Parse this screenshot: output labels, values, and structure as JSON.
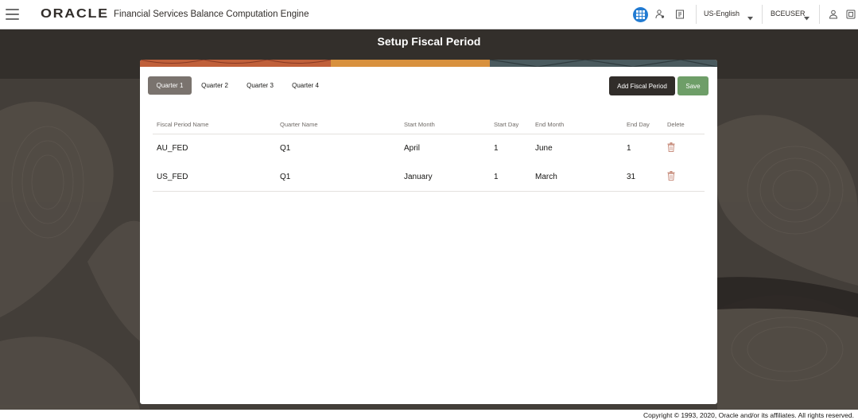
{
  "header": {
    "brand": "ORACLE",
    "app_name": "Financial Services Balance Computation Engine",
    "language": "US-English",
    "user": "BCEUSER"
  },
  "page": {
    "title": "Setup Fiscal Period"
  },
  "tabs": [
    {
      "label": "Quarter 1",
      "active": true
    },
    {
      "label": "Quarter 2",
      "active": false
    },
    {
      "label": "Quarter 3",
      "active": false
    },
    {
      "label": "Quarter 4",
      "active": false
    }
  ],
  "actions": {
    "add_label": "Add Fiscal Period",
    "save_label": "Save"
  },
  "table": {
    "columns": [
      "Fiscal Period Name",
      "Quarter Name",
      "Start Month",
      "Start Day",
      "End Month",
      "End Day",
      "Delete"
    ],
    "rows": [
      [
        "AU_FED",
        "Q1",
        "April",
        "1",
        "June",
        "1"
      ],
      [
        "US_FED",
        "Q1",
        "January",
        "1",
        "March",
        "31"
      ]
    ]
  },
  "icons": {
    "menu": "hamburger-icon",
    "apps": "grid-icon",
    "delete": "trash-icon"
  },
  "colors": {
    "accent": "#227bd2",
    "save": "#6e9e68",
    "dark": "#312d2a",
    "delete": "#c99080"
  },
  "footer": {
    "copyright": "Copyright © 1993, 2020, Oracle and/or its affiliates. All rights reserved."
  }
}
